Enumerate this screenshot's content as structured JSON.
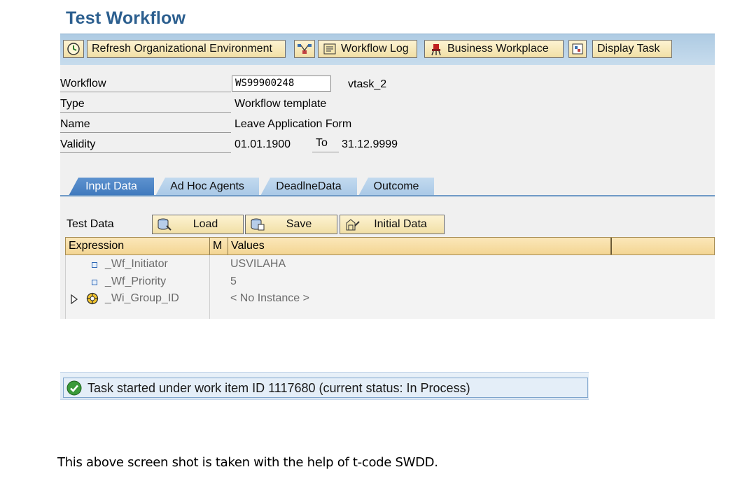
{
  "window": {
    "title": "Test Workflow"
  },
  "toolbar": {
    "refresh_label": "Refresh Organizational Environment",
    "workflow_log_label": "Workflow Log",
    "business_workplace_label": "Business Workplace",
    "display_task_label": "Display Task",
    "icons": [
      "execute-icon",
      "workflow-graph-icon",
      "log-icon",
      "workplace-icon",
      "task-icon"
    ]
  },
  "header": {
    "workflow_label": "Workflow",
    "workflow_value": "WS99900248",
    "workflow_desc": "vtask_2",
    "type_label": "Type",
    "type_value": "Workflow template",
    "name_label": "Name",
    "name_value": "Leave Application Form",
    "validity_label": "Validity",
    "validity_from": "01.01.1900",
    "validity_to_label": "To",
    "validity_to": "31.12.9999"
  },
  "tabs": [
    {
      "label": "Input Data",
      "active": true
    },
    {
      "label": "Ad Hoc Agents",
      "active": false
    },
    {
      "label": "DeadlneData",
      "active": false
    },
    {
      "label": "Outcome",
      "active": false
    }
  ],
  "test_data": {
    "label": "Test Data",
    "load_label": "Load",
    "save_label": "Save",
    "initial_label": "Initial Data"
  },
  "grid": {
    "headers": [
      "Expression",
      "M",
      "Values"
    ],
    "rows": [
      {
        "expression": "_Wf_Initiator",
        "value": "USVILAHA"
      },
      {
        "expression": "_Wf_Priority",
        "value": "5"
      },
      {
        "expression": "_Wi_Group_ID",
        "value": "< No Instance >"
      }
    ]
  },
  "status": {
    "text": "Task started under work item ID 1117680 (current status: In Process)",
    "accent": "#2e8b2e"
  },
  "caption": "This above screen shot is taken with the help of t-code SWDD."
}
